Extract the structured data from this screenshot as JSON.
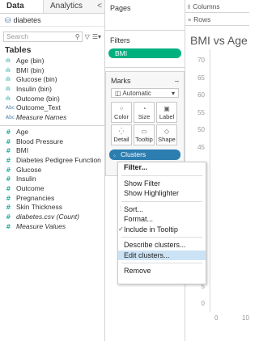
{
  "tabs": {
    "data": "Data",
    "analytics": "Analytics",
    "collapse": "<"
  },
  "datasource": {
    "name": "diabetes"
  },
  "search": {
    "placeholder": "Search"
  },
  "tables_title": "Tables",
  "fields": [
    {
      "type": "bin",
      "label": "Age (bin)"
    },
    {
      "type": "bin",
      "label": "BMI (bin)"
    },
    {
      "type": "bin",
      "label": "Glucose (bin)"
    },
    {
      "type": "bin",
      "label": "Insulin (bin)"
    },
    {
      "type": "bin",
      "label": "Outcome (bin)"
    },
    {
      "type": "abc",
      "label": "Outcome_Text"
    },
    {
      "type": "abc",
      "label": "Measure Names",
      "italic": true
    }
  ],
  "measures": [
    {
      "label": "Age"
    },
    {
      "label": "Blood Pressure"
    },
    {
      "label": "BMI"
    },
    {
      "label": "Diabetes Pedigree Function"
    },
    {
      "label": "Glucose"
    },
    {
      "label": "Insulin"
    },
    {
      "label": "Outcome"
    },
    {
      "label": "Pregnancies"
    },
    {
      "label": "Skin Thickness"
    },
    {
      "label": "diabetes.csv (Count)",
      "italic": true
    },
    {
      "label": "Measure Values",
      "italic": true
    }
  ],
  "pages": {
    "title": "Pages"
  },
  "filters": {
    "title": "Filters",
    "pill": "BMI"
  },
  "marks": {
    "title": "Marks",
    "type": "Automatic",
    "buttons": [
      "Color",
      "Size",
      "Label",
      "Detail",
      "Tooltip",
      "Shape"
    ],
    "pill": "Clusters"
  },
  "shelves": {
    "columns": "Columns",
    "rows": "Rows"
  },
  "chart": {
    "title": "BMI vs Age",
    "yticks": [
      "70",
      "65",
      "60",
      "55",
      "50",
      "45",
      "40",
      "35",
      "30",
      "25",
      "20",
      "15",
      "10",
      "5",
      "0"
    ],
    "xticks": [
      "0",
      "10"
    ]
  },
  "menu": {
    "items": [
      {
        "label": "Filter...",
        "bold": true
      },
      {
        "sep": true
      },
      {
        "label": "Show Filter"
      },
      {
        "label": "Show Highlighter"
      },
      {
        "sep": true
      },
      {
        "label": "Sort...",
        "gutter": "sort"
      },
      {
        "label": "Format..."
      },
      {
        "label": "Include in Tooltip",
        "gutter": "check"
      },
      {
        "sep": true
      },
      {
        "label": "Describe clusters..."
      },
      {
        "label": "Edit clusters...",
        "highlight": true
      },
      {
        "sep": true
      },
      {
        "label": "Remove"
      }
    ]
  },
  "colors": {
    "filter_pill": "#00b180",
    "clusters_pill": "#2d7eb0",
    "menu_highlight": "#cce3f5"
  }
}
